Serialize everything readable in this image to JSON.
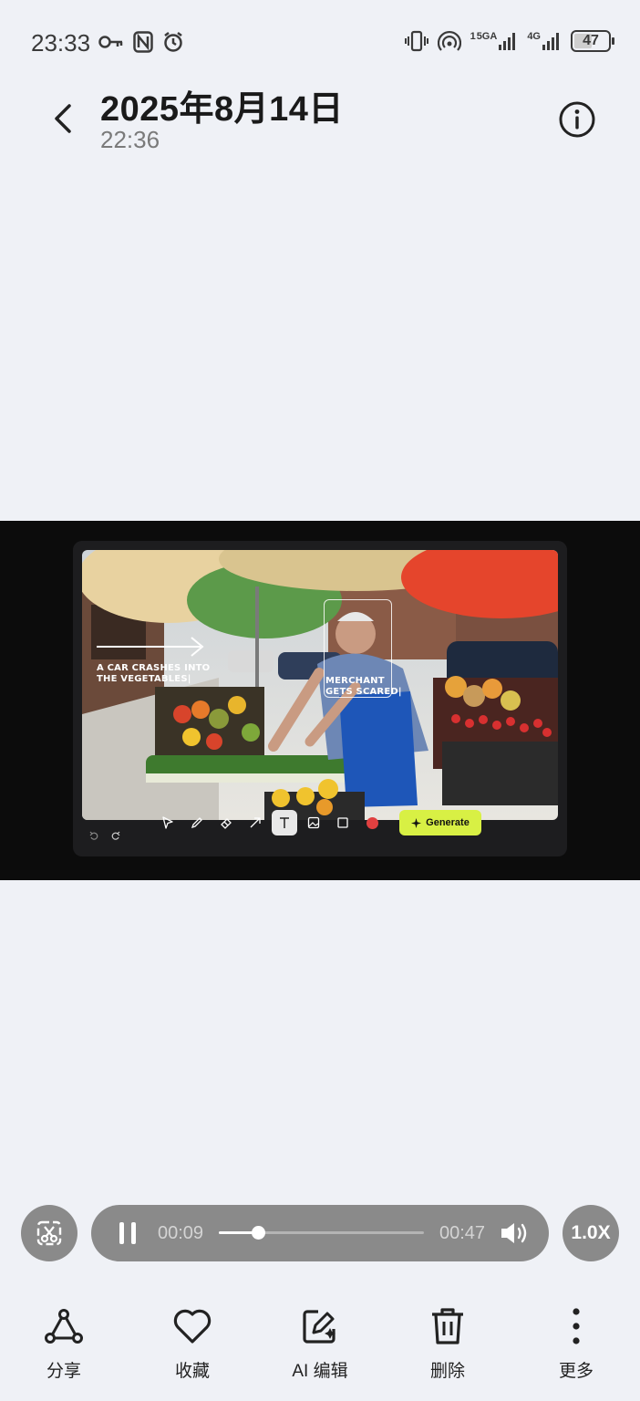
{
  "status_bar": {
    "time": "23:33",
    "signal_1": "5GA",
    "signal_1_prefix": "1",
    "signal_2": "4G",
    "battery": "47"
  },
  "header": {
    "date": "2025年8月14日",
    "time": "22:36"
  },
  "video": {
    "overlay_1": "A CAR CRASHES INTO THE VEGETABLES|",
    "overlay_2": "MERCHANT GETS SCARED|",
    "generate_label": "Generate"
  },
  "player": {
    "current_time": "00:09",
    "total_time": "00:47",
    "progress": 0.19,
    "speed": "1.0X"
  },
  "bottom_bar": {
    "share": "分享",
    "favorite": "收藏",
    "ai_edit": "AI 编辑",
    "delete": "删除",
    "more": "更多"
  },
  "colors": {
    "background": "#eff1f6",
    "control_gray": "#8a8a8a",
    "generate_accent": "#d8f044"
  }
}
